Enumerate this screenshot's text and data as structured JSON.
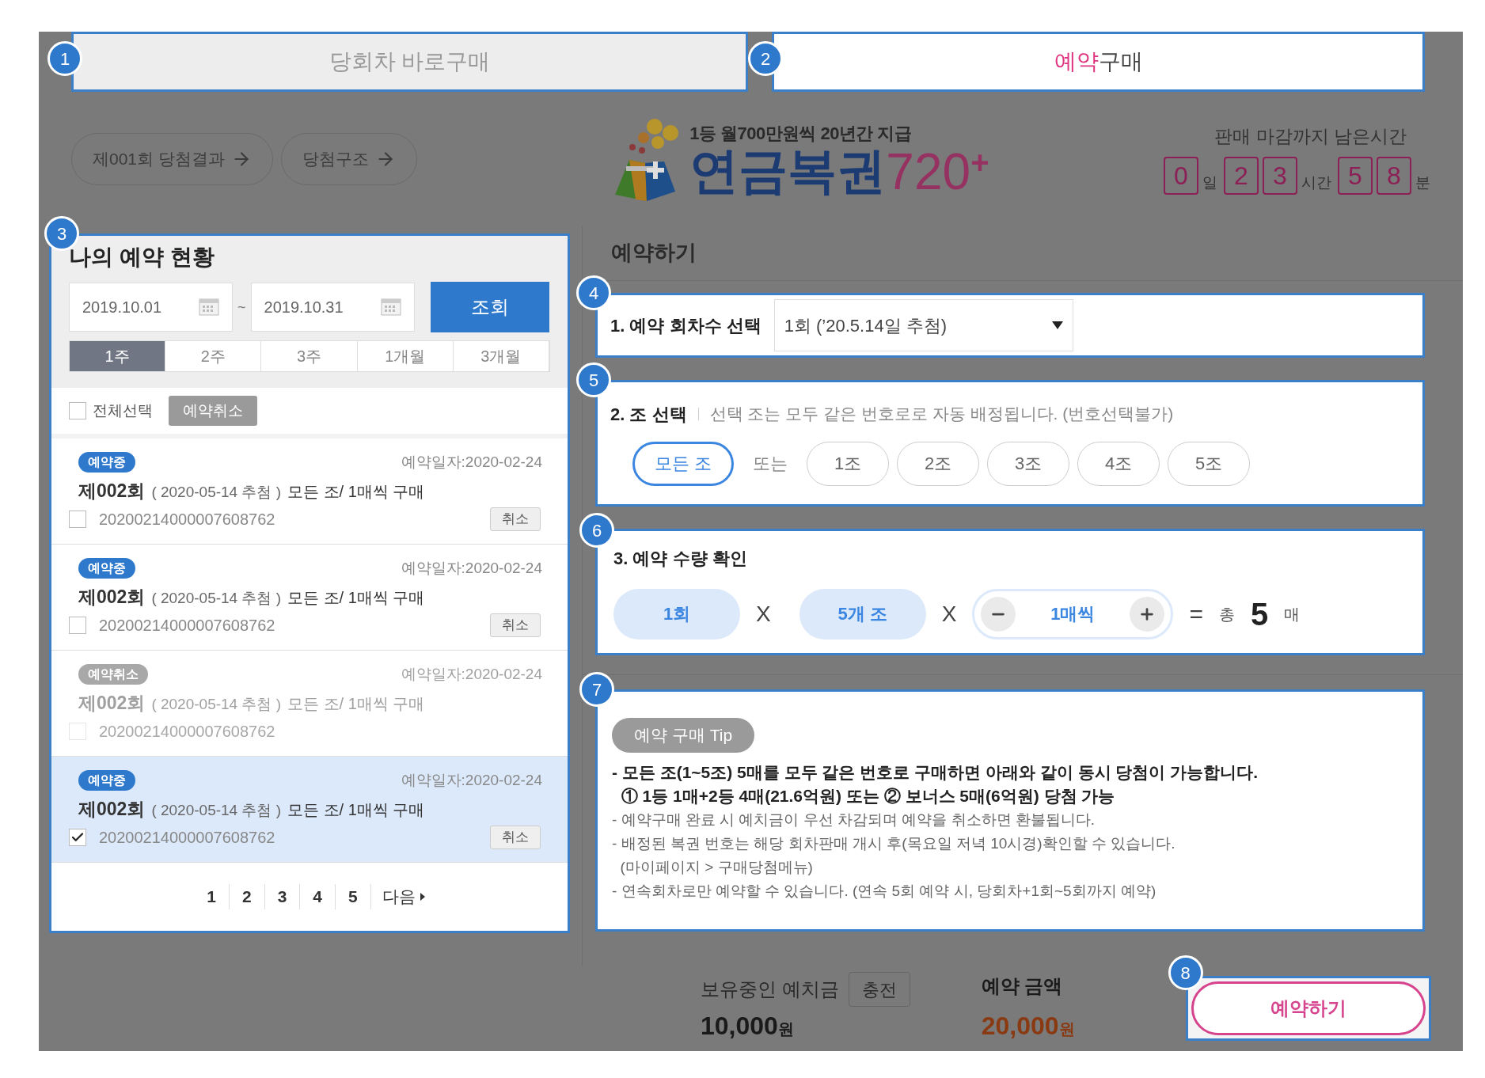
{
  "tabs": [
    {
      "badge": "1",
      "label": "당회차 바로구매",
      "selected": false
    },
    {
      "badge": "2",
      "accent": "예약",
      "label": "구매",
      "selected": true
    }
  ],
  "header": {
    "links": [
      "제001회 당첨결과",
      "당첨구조"
    ],
    "logo": {
      "tagline": "1등 월700만원씩 20년간 지급",
      "name": "연금복권",
      "number": "720",
      "plus": "+"
    },
    "countdown": {
      "title": "판매 마감까지 남은시간",
      "groups": [
        {
          "digits": [
            "0"
          ],
          "unit": "일"
        },
        {
          "digits": [
            "2",
            "3"
          ],
          "unit": "시간"
        },
        {
          "digits": [
            "5",
            "8"
          ],
          "unit": "분"
        }
      ]
    }
  },
  "my_reservations": {
    "badge": "3",
    "title": "나의 예약 현황",
    "date_from": "2019.10.01",
    "separator": "~",
    "date_to": "2019.10.31",
    "search_button": "조회",
    "periods": [
      {
        "label": "1주",
        "selected": true
      },
      {
        "label": "2주",
        "selected": false
      },
      {
        "label": "3주",
        "selected": false
      },
      {
        "label": "1개월",
        "selected": false
      },
      {
        "label": "3개월",
        "selected": false
      }
    ],
    "select_all": {
      "label": "전체선택",
      "checked": false
    },
    "cancel_selected_button": "예약취소",
    "items": [
      {
        "kind": "active",
        "status": "예약중",
        "date": "예약일자:2020-02-24",
        "round": "제002회",
        "detail": "( 2020-05-14 추첨 )",
        "summary": "모든 조/ 1매씩 구매",
        "number": "20200214000007608762",
        "checked": false,
        "selected": false,
        "cancel": "취소"
      },
      {
        "kind": "active",
        "status": "예약중",
        "date": "예약일자:2020-02-24",
        "round": "제002회",
        "detail": "( 2020-05-14 추첨 )",
        "summary": "모든 조/ 1매씩 구매",
        "number": "20200214000007608762",
        "checked": false,
        "selected": false,
        "cancel": "취소"
      },
      {
        "kind": "cancelled",
        "status": "예약취소",
        "date": "예약일자:2020-02-24",
        "round": "제002회",
        "detail": "( 2020-05-14 추첨 )",
        "summary": "모든 조/ 1매씩 구매",
        "number": "20200214000007608762",
        "checked": false,
        "selected": false
      },
      {
        "kind": "active",
        "status": "예약중",
        "date": "예약일자:2020-02-24",
        "round": "제002회",
        "detail": "( 2020-05-14 추첨 )",
        "summary": "모든 조/ 1매씩 구매",
        "number": "20200214000007608762",
        "checked": true,
        "selected": true,
        "cancel": "취소"
      }
    ],
    "pages": [
      "1",
      "2",
      "3",
      "4",
      "5"
    ],
    "next": "다음"
  },
  "reserve": {
    "title": "예약하기",
    "step_round": {
      "badge": "4",
      "label": "1. 예약 회차수 선택",
      "value": "1회 (’20.5.14일 추첨)"
    },
    "step_group": {
      "badge": "5",
      "label": "2. 조 선택",
      "hint": "선택 조는 모두 같은 번호로로 자동 배정됩니다. (번호선택불가)",
      "all_option": {
        "label": "모든 조",
        "selected": true
      },
      "or": "또는",
      "options": [
        {
          "label": "1조",
          "selected": false
        },
        {
          "label": "2조",
          "selected": false
        },
        {
          "label": "3조",
          "selected": false
        },
        {
          "label": "4조",
          "selected": false
        },
        {
          "label": "5조",
          "selected": false
        }
      ]
    },
    "step_quantity": {
      "badge": "6",
      "label": "3. 예약 수량 확인",
      "rounds": "1회",
      "times": "X",
      "groups": "5개 조",
      "times_2": "X",
      "per": "1매씩",
      "equals": "=",
      "total_prefix": "총",
      "total": "5",
      "unit": "매"
    },
    "tip": {
      "badge": "7",
      "tag": "예약 구매 Tip",
      "lines": [
        {
          "text": "- 모든 조(1~5조) 5매를 모두 같은 번호로 구매하면 아래와 같이 동시 당첨이 가능합니다.",
          "bold": true
        },
        {
          "text": "  ① 1등 1매+2등 4매(21.6억원) 또는 ② 보너스 5매(6억원) 당첨 가능",
          "bold": true
        },
        {
          "text": "- 예약구매 완료 시 예치금이 우선 차감되며 예약을 취소하면 환불됩니다.",
          "bold": false
        },
        {
          "text": "- 배정된 복권 번호는 해당 회차판매 개시 후(목요일 저녁 10시경)확인할 수 있습니다.",
          "bold": false
        },
        {
          "text": "  (마이페이지 > 구매당첨메뉴)",
          "bold": false
        },
        {
          "text": "- 연속회차로만 예약할 수 있습니다. (연속 5회 예약 시, 당회차+1회~5회까지 예약)",
          "bold": false
        }
      ]
    }
  },
  "footer": {
    "deposit_label": "보유중인 예치금",
    "charge_button": "충전",
    "deposit": "10,000",
    "deposit_unit": "원",
    "amount_label": "예약 금액",
    "amount": "20,000",
    "amount_unit": "원",
    "reserve_badge": "8",
    "reserve_button": "예약하기"
  }
}
